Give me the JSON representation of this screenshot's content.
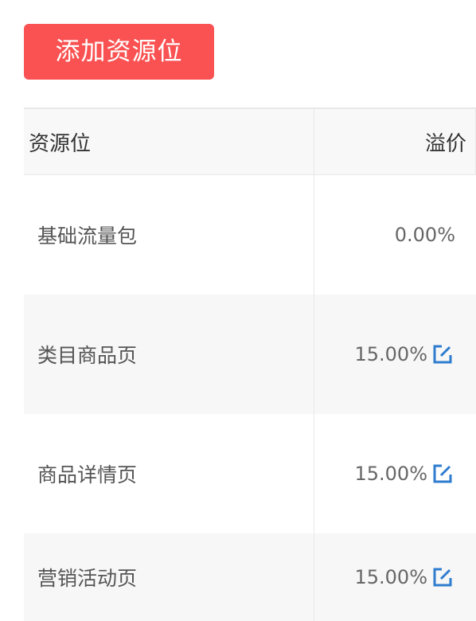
{
  "add_button": {
    "label": "添加资源位"
  },
  "table": {
    "columns": [
      "资源位",
      "溢价"
    ],
    "rows": [
      {
        "name": "基础流量包",
        "premium": "0.00%",
        "editable": false
      },
      {
        "name": "类目商品页",
        "premium": "15.00%",
        "editable": true
      },
      {
        "name": "商品详情页",
        "premium": "15.00%",
        "editable": true
      },
      {
        "name": "营销活动页",
        "premium": "15.00%",
        "editable": true
      }
    ]
  },
  "colors": {
    "accent": "#fa5252",
    "edit_icon": "#2f7ccf"
  },
  "icons": {
    "edit": "edit-icon"
  }
}
